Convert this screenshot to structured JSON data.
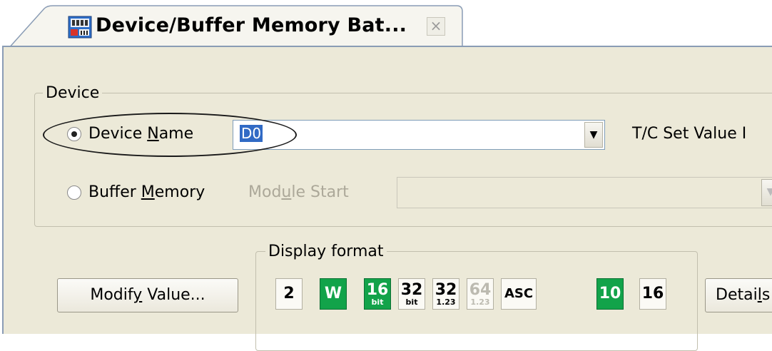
{
  "tab": {
    "title": "Device/Buffer Memory Bat...",
    "close_glyph": "×"
  },
  "device_group": {
    "legend": "Device",
    "device_name_radio": {
      "label_pre": "Device ",
      "label_key": "N",
      "label_post": "ame",
      "checked": true
    },
    "device_name_value": "D0",
    "tc_set_value_label": "T/C Set Value I",
    "buffer_memory_radio": {
      "label_pre": "Buffer ",
      "label_key": "M",
      "label_post": "emory",
      "checked": false
    },
    "module_start": {
      "pre": "Mod",
      "key": "u",
      "post": "le Start"
    }
  },
  "modify_button": {
    "pre": "Modif",
    "key": "y",
    "post": " Value..."
  },
  "display_format": {
    "legend": "Display format",
    "buttons": [
      {
        "name": "bin",
        "top": "2",
        "bottom": "",
        "state": "normal"
      },
      {
        "name": "word",
        "top": "W",
        "bottom": "",
        "state": "on"
      },
      {
        "name": "16bit",
        "top": "16",
        "bottom": "bit",
        "state": "on"
      },
      {
        "name": "32bit",
        "top": "32",
        "bottom": "bit",
        "state": "normal"
      },
      {
        "name": "32real",
        "top": "32",
        "bottom": "1.23",
        "state": "normal"
      },
      {
        "name": "64real",
        "top": "64",
        "bottom": "1.23",
        "state": "disabled"
      },
      {
        "name": "ascii",
        "top": "ASC",
        "bottom": "",
        "state": "normal"
      },
      {
        "name": "dec",
        "top": "10",
        "bottom": "",
        "state": "on"
      },
      {
        "name": "hex",
        "top": "16",
        "bottom": "",
        "state": "normal"
      }
    ]
  },
  "details_button": {
    "pre": "Detai",
    "key": "l",
    "post": "s"
  },
  "icons": [
    "app-icon",
    "close-icon",
    "dropdown-arrow-icon"
  ]
}
